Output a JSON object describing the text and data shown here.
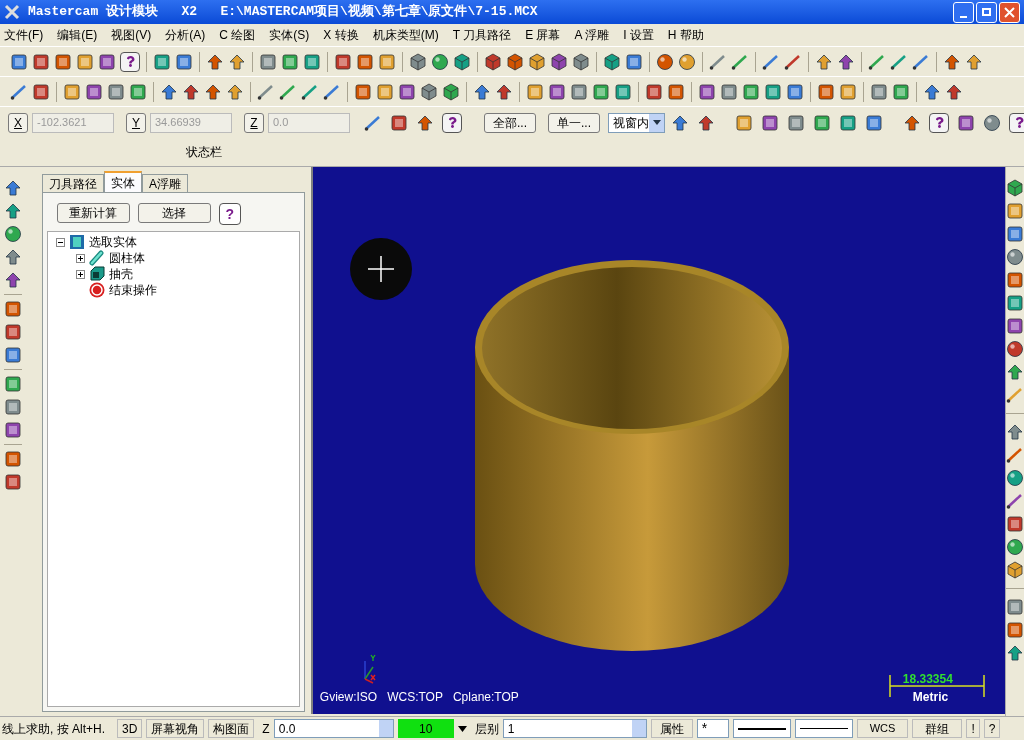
{
  "window": {
    "title": "Mastercam 设计模块   X2   E:\\MASTERCAM项目\\视频\\第七章\\原文件\\7-15.MCX"
  },
  "menu": [
    "文件(F)",
    "编辑(E)",
    "视图(V)",
    "分析(A)",
    "C 绘图",
    "实体(S)",
    "X 转换",
    "机床类型(M)",
    "T 刀具路径",
    "E 屏幕",
    "A 浮雕",
    "I 设置",
    "H 帮助"
  ],
  "coordinates": [
    {
      "axis": "X",
      "value": "-102.3621",
      "disabled": true
    },
    {
      "axis": "Y",
      "value": "34.66939",
      "disabled": true
    },
    {
      "axis": "Z",
      "value": "0.0",
      "disabled": true
    }
  ],
  "selection": {
    "buttons": [
      "全部...",
      "单一..."
    ],
    "mode": "视窗内"
  },
  "toolbar_label": "状态栏",
  "panel": {
    "tabs": [
      {
        "label": "刀具路径",
        "selected": false
      },
      {
        "label": "实体",
        "selected": true
      },
      {
        "label": "A浮雕",
        "selected": false
      }
    ],
    "buttons": [
      "重新计算",
      "选择"
    ],
    "help": "?",
    "tree": [
      {
        "label": "选取实体",
        "kind": "solid",
        "expanded": true,
        "children": [
          {
            "label": "圆柱体",
            "kind": "cylinder",
            "expanded": false
          },
          {
            "label": "抽壳",
            "kind": "shell",
            "expanded": false
          },
          {
            "label": "结束操作",
            "kind": "end"
          }
        ]
      }
    ]
  },
  "viewport": {
    "info": [
      "Gview:ISO",
      "WCS:TOP",
      "Cplane:TOP"
    ],
    "scale": {
      "value": "18.33354",
      "unit": "Metric"
    }
  },
  "status_bar": {
    "help": "线上求助, 按 Alt+H.",
    "buttons": [
      "3D",
      "屏幕视角",
      "构图面"
    ],
    "z_label": "Z",
    "z_value": "0.0",
    "color_number": "10",
    "level_label": "层别",
    "level": "1",
    "attributes": "属性",
    "point_style": "*",
    "wcs": "WCS",
    "group": "群组",
    "buttons_right": [
      "!",
      "?"
    ]
  }
}
